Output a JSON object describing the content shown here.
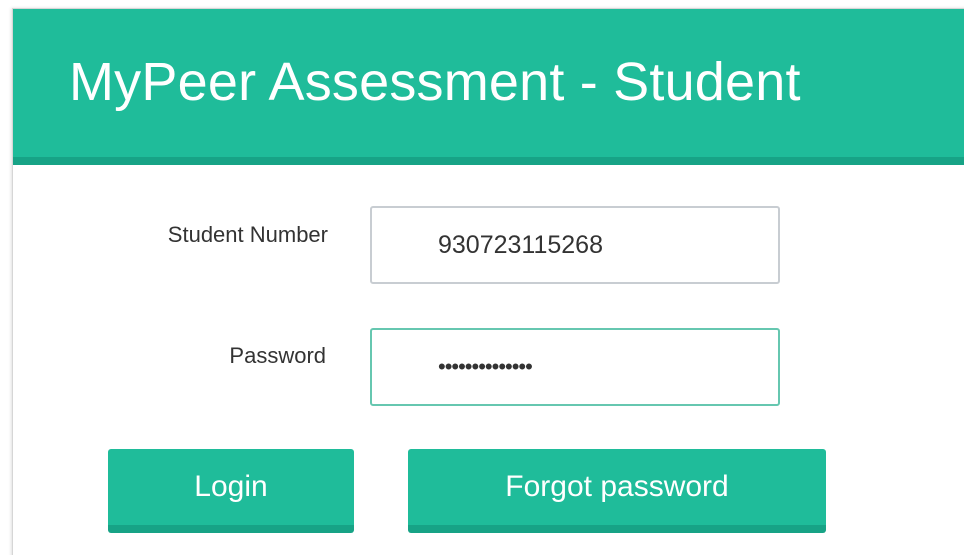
{
  "header": {
    "title": "MyPeer Assessment - Student"
  },
  "form": {
    "student_number": {
      "label": "Student Number",
      "value": "930723115268"
    },
    "password": {
      "label": "Password",
      "value": "••••••••••••••"
    },
    "buttons": {
      "login_label": "Login",
      "forgot_label": "Forgot password"
    }
  },
  "colors": {
    "accent": "#1fbc9a",
    "accent_dark": "#17a386"
  }
}
